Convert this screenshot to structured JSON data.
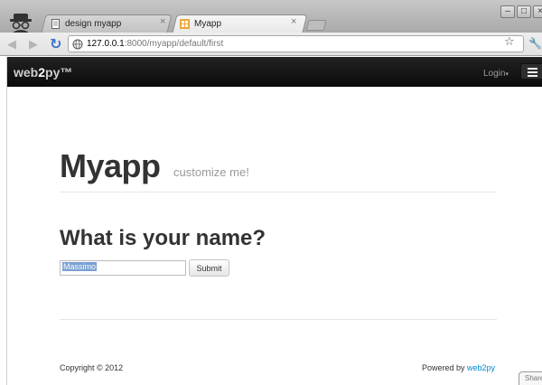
{
  "browser": {
    "tabs": [
      {
        "title": "design myapp",
        "active": false
      },
      {
        "title": "Myapp",
        "active": true
      }
    ],
    "url_host": "127.0.0.1",
    "url_rest": ":8000/myapp/default/first",
    "window_buttons": [
      "–",
      "□",
      "×"
    ]
  },
  "navbar": {
    "brand_prefix": "web",
    "brand_two": "2",
    "brand_suffix": "py™",
    "login_label": "Login"
  },
  "page": {
    "title": "Myapp",
    "subtitle": "customize me!",
    "question": "What is your name?",
    "input_value": "Massimo",
    "submit_label": "Submit"
  },
  "footer": {
    "copyright": "Copyright © 2012",
    "powered_prefix": "Powered by ",
    "powered_link": "web2py"
  },
  "share_label": "Share",
  "colors": {
    "navbar_bg": "#111111",
    "link": "#0088cc",
    "title": "#333333",
    "subtitle": "#999999"
  },
  "icons": [
    "incognito-icon",
    "document-icon",
    "web2py-favicon-icon",
    "back-icon",
    "forward-icon",
    "reload-icon",
    "globe-icon",
    "star-icon",
    "wrench-icon",
    "menu-icon"
  ]
}
